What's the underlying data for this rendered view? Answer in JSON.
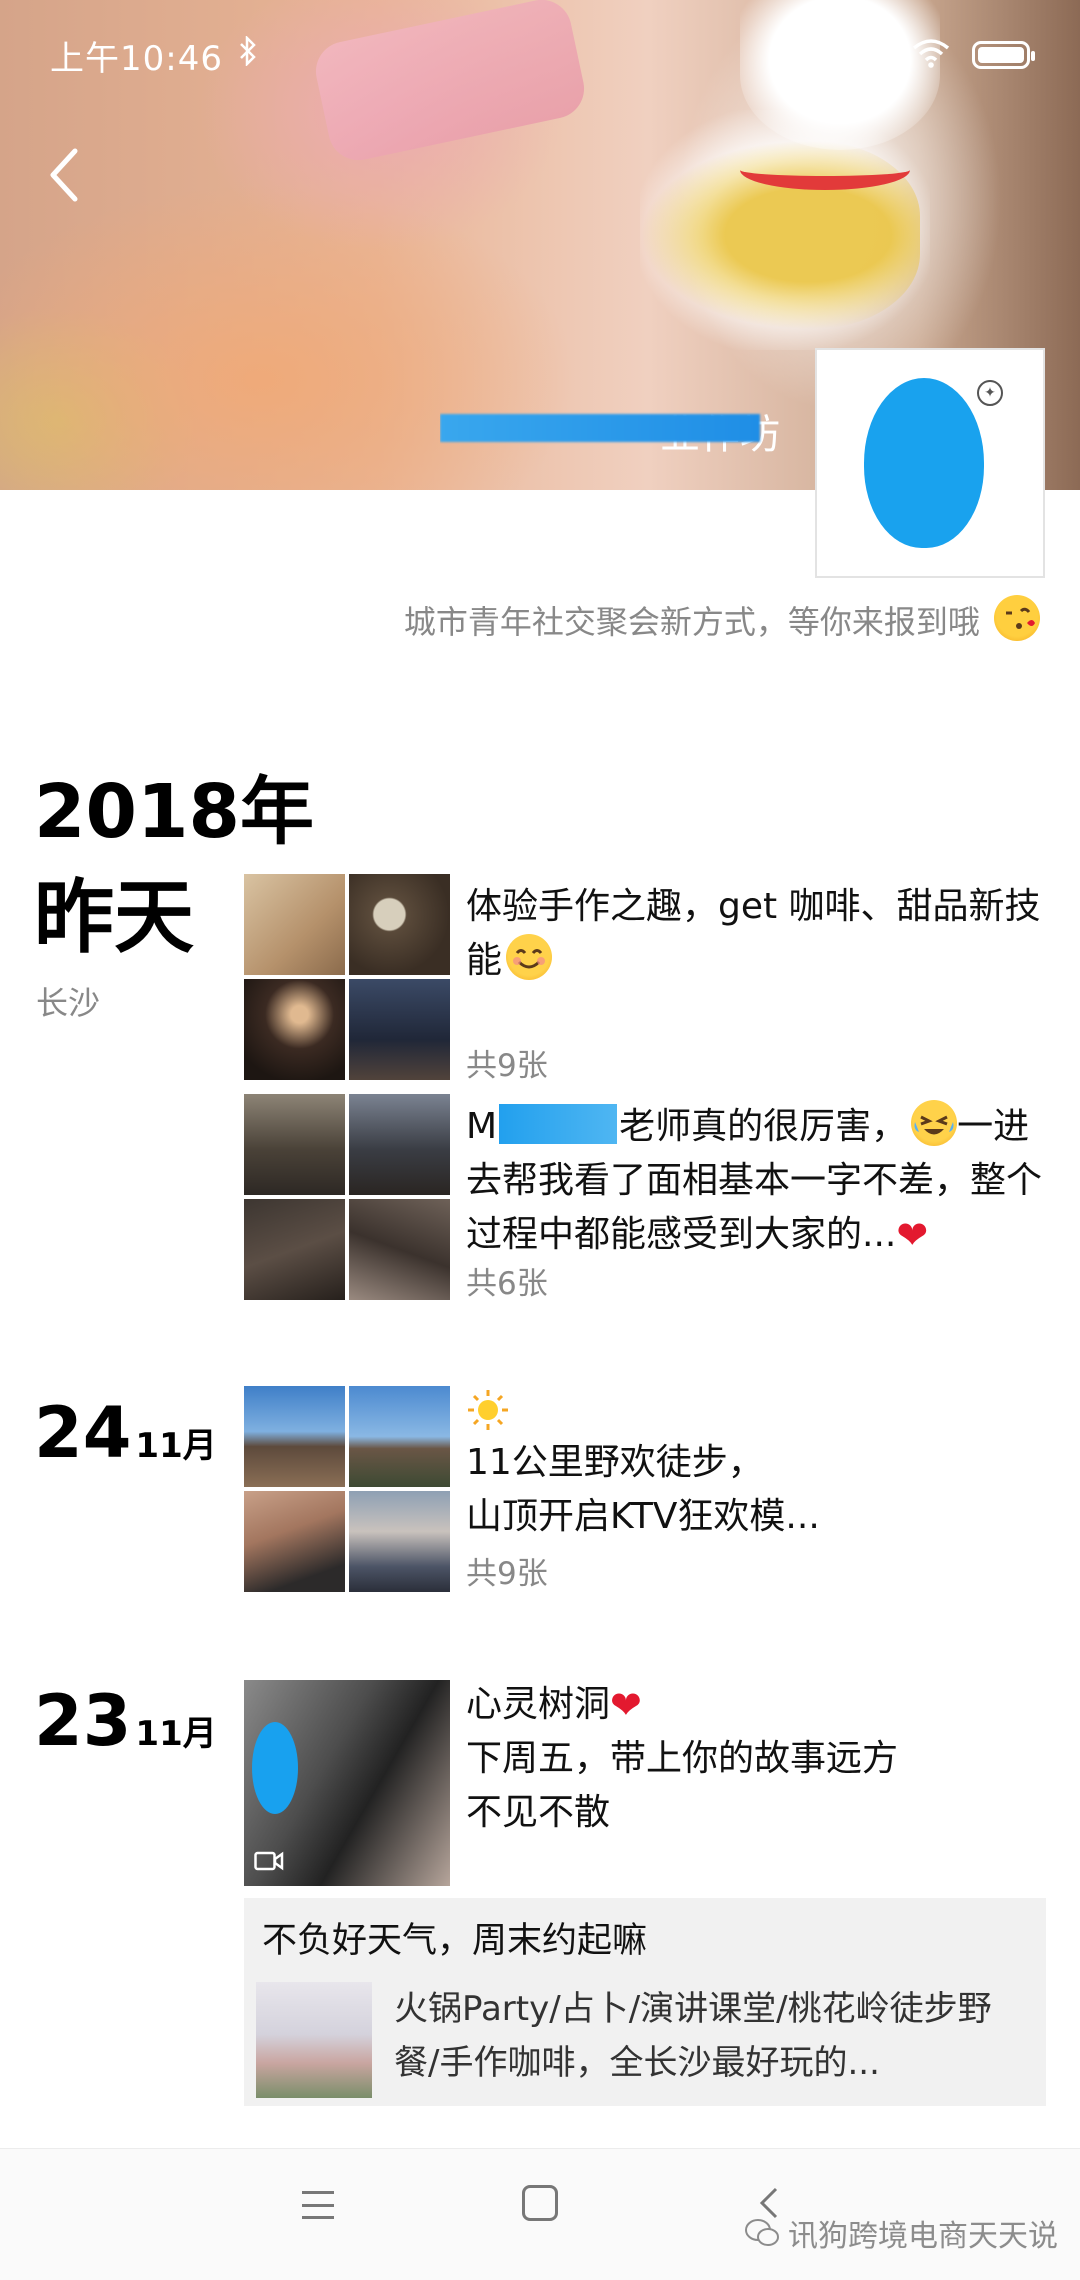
{
  "status_bar": {
    "time": "上午10:46",
    "battery_level": 1.0
  },
  "profile": {
    "cover_name": "业作坊",
    "avatar_caption": "",
    "signature": "城市青年社交聚会新方式，等你来报到哦"
  },
  "timeline": {
    "year": "2018年",
    "days": [
      {
        "label": "昨天",
        "location": "长沙",
        "posts": [
          {
            "text": "体验手作之趣，get 咖啡、甜品新技能",
            "emoji": "smiling-face",
            "count": "共9张",
            "thumbs": [
              "#c9a987",
              "#6e5a45",
              "#4a3328",
              "#2c3346"
            ]
          },
          {
            "prefix": "M",
            "text": "老师真的很厉害，",
            "text_after_emoji": "一进去帮我看了面相基本一字不差，整个过程中都能感受到大家的...",
            "emoji": "laughing-tears-face",
            "trailing_icon": "heart",
            "count": "共6张",
            "thumbs": [
              "#6c6358",
              "#4b4e55",
              "#3d3631",
              "#5a4e48"
            ]
          }
        ]
      },
      {
        "day": "24",
        "month": "11月",
        "posts": [
          {
            "leading_icon": "sun",
            "line1": "11公里野欢徒步，",
            "line2": "山顶开启KTV狂欢模...",
            "count": "共9张",
            "thumbs": [
              "#4d86c7",
              "#5a90c9",
              "#b8856a",
              "#6f7d8e"
            ]
          }
        ]
      },
      {
        "day": "23",
        "month": "11月",
        "posts": [
          {
            "line1": "心灵树洞",
            "line1_icon": "heart",
            "line2": "下周五，带上你的故事远方",
            "line3": "不见不散",
            "media": "video"
          }
        ],
        "share": {
          "title": "不负好天气，周末约起嘛",
          "description": "火锅Party/占卜/演讲课堂/桃花岭徒步野餐/手作咖啡，全长沙最好玩的..."
        }
      }
    ]
  },
  "nav_bar": {
    "watermark": "讯狗跨境电商天天说"
  },
  "colors": {
    "redaction_blue": "#1f9bea",
    "heart_red": "#e3192f",
    "secondary_text": "#888888"
  }
}
